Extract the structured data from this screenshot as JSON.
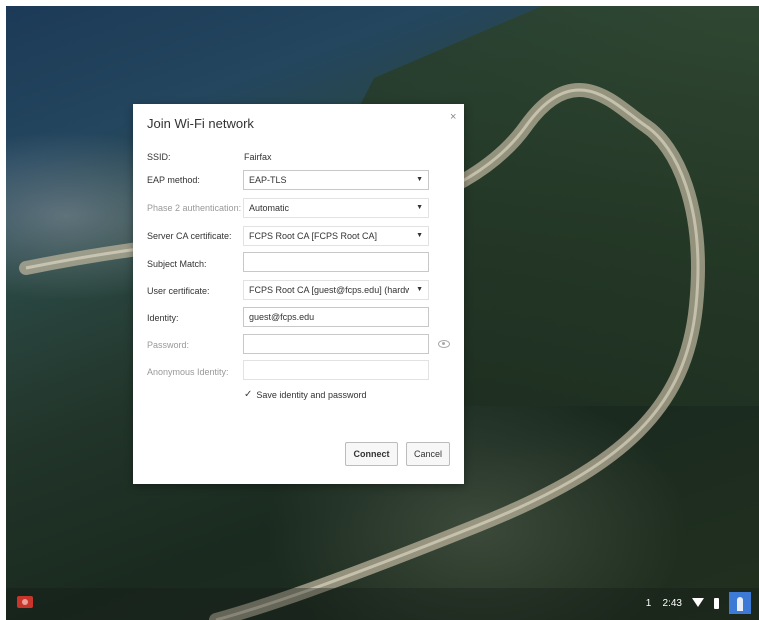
{
  "dialog": {
    "title": "Join Wi-Fi network",
    "close_symbol": "×",
    "ssid_label": "SSID:",
    "ssid_value": "Fairfax",
    "eap_method_label": "EAP method:",
    "eap_method_value": "EAP-TLS",
    "phase2_label": "Phase 2 authentication:",
    "phase2_value": "Automatic",
    "server_ca_label": "Server CA certificate:",
    "server_ca_value": "FCPS Root CA [FCPS Root CA]",
    "subject_match_label": "Subject Match:",
    "subject_match_value": "",
    "user_cert_label": "User certificate:",
    "user_cert_value": "FCPS Root CA [guest@fcps.edu] (hardwa",
    "identity_label": "Identity:",
    "identity_value": "guest@fcps.edu",
    "password_label": "Password:",
    "password_value": "",
    "anon_identity_label": "Anonymous Identity:",
    "anon_identity_value": "",
    "save_label": "Save identity and password",
    "save_checked": true,
    "connect_label": "Connect",
    "cancel_label": "Cancel"
  },
  "shelf": {
    "notification_count": "1",
    "time": "2:43",
    "launcher_color": "#c8362b",
    "avatar_color": "#3d7ad6"
  },
  "icons": {
    "dropdown": "chevron-down-icon",
    "password_visibility": "eye-icon",
    "check": "check-icon",
    "close": "close-icon",
    "wifi": "wifi-icon",
    "battery": "battery-icon"
  }
}
